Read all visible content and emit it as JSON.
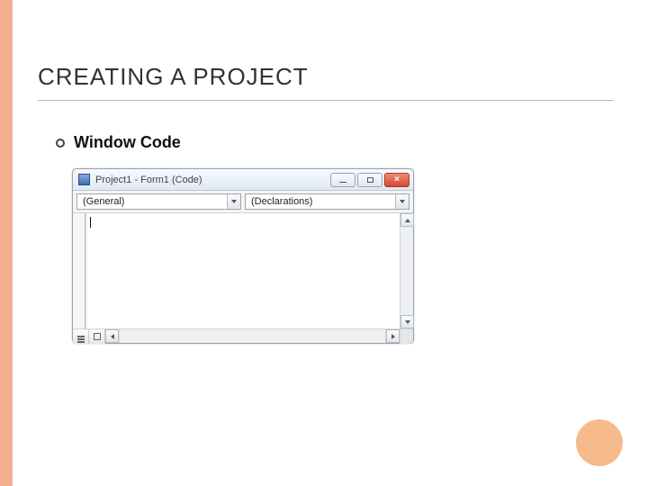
{
  "slide": {
    "title": "CREATING A PROJECT",
    "bullet1": "Window Code"
  },
  "code_window": {
    "title": "Project1 - Form1 (Code)",
    "object_dropdown": "(General)",
    "procedure_dropdown": "(Declarations)"
  }
}
